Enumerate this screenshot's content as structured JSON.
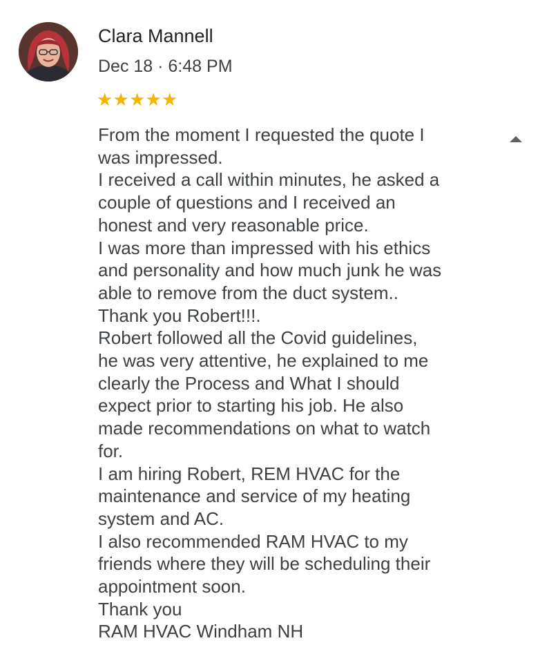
{
  "review": {
    "reviewer_name": "Clara Mannell",
    "date": "Dec 18 · 6:48 PM",
    "rating": 5,
    "star_color": "#f4b400",
    "star_glyph": "★",
    "lines": [
      "From the moment I requested the quote I",
      "was impressed.",
      "I received a call within minutes, he asked a",
      "couple of questions and I received an",
      "honest and very reasonable price.",
      "I was more than impressed with his ethics",
      "and personality and how much junk he was",
      "able to remove from the duct system..",
      "Thank you Robert!!!.",
      "Robert followed all the Covid guidelines,",
      "he was very attentive, he explained to me",
      "clearly the Process and What I should",
      "expect prior to starting his job. He also",
      "made recommendations on what to watch",
      "for.",
      "I am hiring  Robert, REM HVAC for the",
      "maintenance and service of my heating",
      "system and AC.",
      "I also recommended  RAM HVAC to my",
      "friends where they will be scheduling their",
      "appointment soon.",
      "Thank you",
      "RAM HVAC Windham NH"
    ]
  },
  "icons": {
    "avatar": "profile-photo",
    "collapse": "triangle-up-icon"
  }
}
